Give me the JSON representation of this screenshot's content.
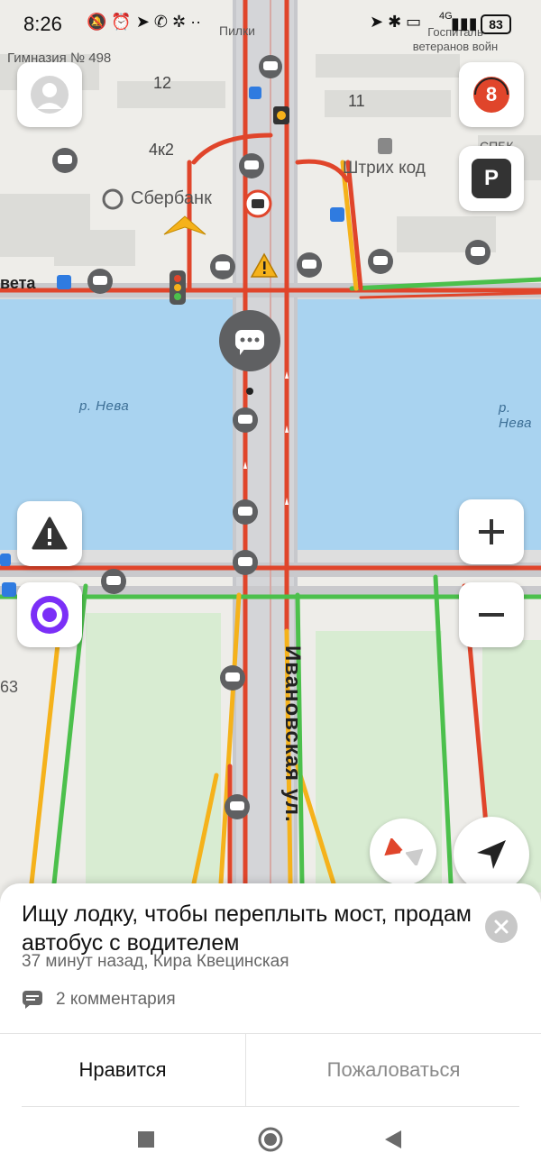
{
  "status_bar": {
    "time": "8:26",
    "battery": "83",
    "network": "4G"
  },
  "map": {
    "labels": {
      "school": "Гимназия № 498",
      "house_12": "12",
      "house_11": "11",
      "house_4k2": "4к2",
      "sberbank": "Сбербанк",
      "shtrikh_kod": "Штрих код",
      "pilki": "Пилки",
      "veterans_hospital": "Госпиталь ветеранов войн",
      "veta": "вета",
      "river_left": "р. Нева",
      "river_right": "р. Нева",
      "street": "Ивановская ул.",
      "house_63": "63",
      "sbek": "СПБК"
    },
    "traffic_score": "8",
    "parking_label": "P"
  },
  "card": {
    "title": "Ищу лодку, чтобы переплыть мост, продам автобус с водителем",
    "meta": "37 минут назад, Кира Квецинская",
    "comments": "2 комментария",
    "like_label": "Нравится",
    "report_label": "Пожаловаться"
  },
  "colors": {
    "water": "#a9d3f0",
    "traffic_red": "#e0452b",
    "traffic_yellow": "#f5b21b",
    "traffic_green": "#4cc04c",
    "alice": "#7b2ff7"
  },
  "icons": [
    "avatar-icon",
    "traffic-score-icon",
    "parking-icon",
    "road-alert-icon",
    "zoom-in-icon",
    "zoom-out-icon",
    "alice-icon",
    "compass-icon",
    "locate-icon",
    "close-icon",
    "comment-icon",
    "nav-recent-icon",
    "nav-home-icon",
    "nav-back-icon"
  ]
}
